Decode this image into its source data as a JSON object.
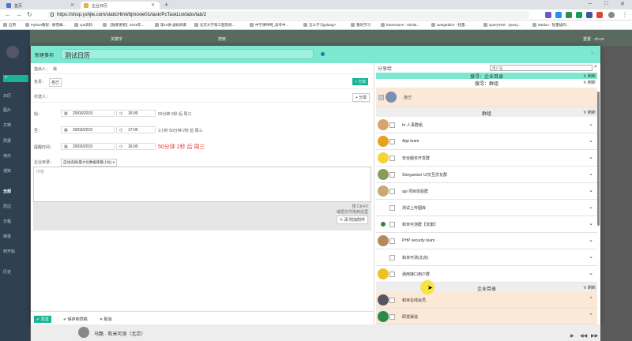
{
  "browser": {
    "tabs": [
      {
        "label": "首页",
        "color": "#4a7bd0"
      },
      {
        "label": "企业日历",
        "color": "#e8b23a"
      }
    ],
    "newtab": "+",
    "url": "https://shop.yshjle.com/staticHtml/bjmovie01/task/PcTaskList/tabs/tab/2",
    "window_controls": [
      "–",
      "□",
      "✕"
    ],
    "bookmarks": [
      "应用",
      "Python教程 - 廖雪峰...",
      "cpa资料",
      "【独家更新】2018年...",
      "第10讲 虚拟商家",
      "北京大学第三医院排...",
      "中学课件网_高考中...",
      "怎么学习golang?",
      "我的学习",
      "Extensions - Simila...",
      "wangEditor - 轻量...",
      "QueryTest - Query...",
      "Medoo - 轻量级的..."
    ]
  },
  "sidebar": {
    "items": [
      "日历",
      "图片",
      "文档",
      "周报",
      "待办",
      "通知",
      "全部",
      "周边",
      "日程",
      "审批",
      "到开始",
      "历史"
    ],
    "new_button": "+"
  },
  "topstrip": {
    "left_text": "关键字",
    "mid_text": "搜索",
    "right_text": "重置 · zh-cn"
  },
  "modal": {
    "header_label": "新建事项",
    "title_value": "测试日历",
    "close": "×",
    "creator": {
      "label": "指派人：",
      "value": "我"
    },
    "assignee": {
      "label": "负责：",
      "chip": "自己",
      "button": "+ 分享"
    },
    "cc": {
      "label": "抄送人：",
      "button": "+ 分享"
    },
    "start": {
      "label": "始：",
      "date": "20/03/2019",
      "time": "16:00",
      "duration": "50分钟 2秒 后 周三"
    },
    "end": {
      "label": "至：",
      "date": "20/03/2019",
      "time": "17:00",
      "duration": "1小时 50分钟 2秒 后 周三"
    },
    "remind": {
      "label": "提醒时间：",
      "date": "20/03/2019",
      "time": "16:00",
      "duration": "50分钟 2秒 后 周三"
    },
    "enterprise": {
      "label": "企业目录：",
      "select": "自动选择(最大化数据库最小化) ▾"
    },
    "content_placeholder": "内容",
    "drop_hint_1": "按 Ctrl+V",
    "drop_hint_2": "或把文件拖到这里",
    "attach_button": "✎ 添 附加附件",
    "footer": {
      "send": "✔ 发送",
      "save_draft": "✔ 保存到草稿",
      "cancel": "✕ 取消"
    }
  },
  "share_panel": {
    "label": "分享给",
    "search_placeholder": "用户名",
    "search_enterprise": "搜寻：企业目录",
    "search_group": "搜寻：群组",
    "refresh": "刷新",
    "self_name": "自己",
    "groups_title": "群组",
    "groups": [
      "hr 人事群组",
      "App team",
      "安全服务开发群",
      "Storganiser UI交互优化群",
      "api 项目体验群",
      "测试上传图库",
      "和米可测群【安康】",
      "PHP security team",
      "和米可测(北京)",
      "通用接口用户群"
    ],
    "enterprise_title": "企业目录",
    "enterprise": [
      "和米在线会员",
      "研发渠道"
    ]
  },
  "taskbar": {
    "name": "马飘 · 和米可测（北京）",
    "video_controls": [
      "▶",
      "◀◀",
      "▶▶",
      "✕",
      "⛶"
    ]
  },
  "colors": {
    "accent": "#1ab394",
    "header": "#7de8d0",
    "highlight": "#fbe8d6"
  }
}
